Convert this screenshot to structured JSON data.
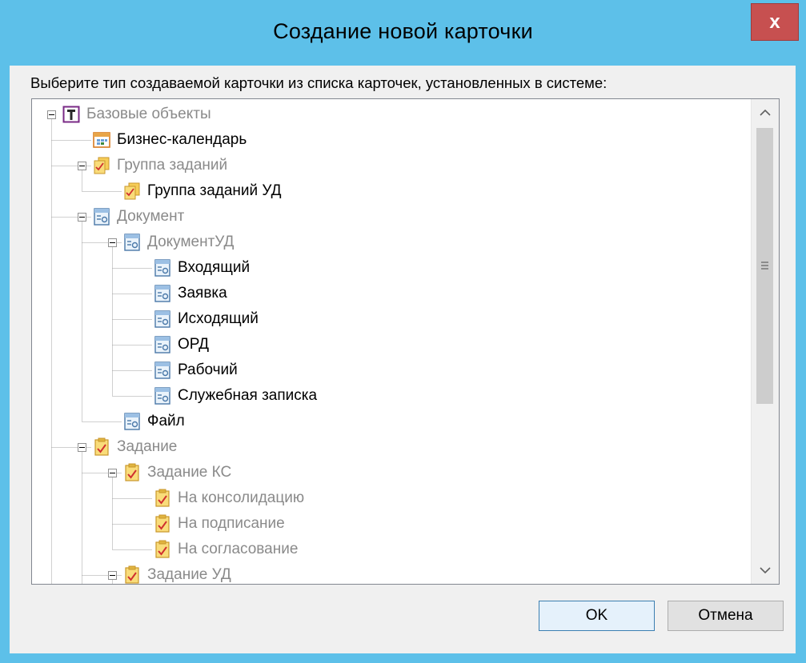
{
  "window": {
    "title": "Создание новой карточки",
    "close_label": "x"
  },
  "prompt": "Выберите тип создаваемой карточки из списка карточек, установленных в системе:",
  "tree": [
    {
      "label": "Базовые объекты",
      "icon": "tools-icon",
      "enabled": false,
      "expanded": true
    },
    {
      "label": "Бизнес-календарь",
      "icon": "calendar-icon",
      "enabled": true
    },
    {
      "label": "Группа заданий",
      "icon": "task-group-icon",
      "enabled": false,
      "expanded": true
    },
    {
      "label": "Группа заданий УД",
      "icon": "task-group-icon",
      "enabled": true
    },
    {
      "label": "Документ",
      "icon": "document-icon",
      "enabled": false,
      "expanded": true
    },
    {
      "label": "ДокументУД",
      "icon": "document-icon",
      "enabled": false,
      "expanded": true
    },
    {
      "label": "Входящий",
      "icon": "document-icon",
      "enabled": true
    },
    {
      "label": "Заявка",
      "icon": "document-icon",
      "enabled": true
    },
    {
      "label": "Исходящий",
      "icon": "document-icon",
      "enabled": true
    },
    {
      "label": "ОРД",
      "icon": "document-icon",
      "enabled": true
    },
    {
      "label": "Рабочий",
      "icon": "document-icon",
      "enabled": true
    },
    {
      "label": "Служебная записка",
      "icon": "document-icon",
      "enabled": true
    },
    {
      "label": "Файл",
      "icon": "document-icon",
      "enabled": true
    },
    {
      "label": "Задание",
      "icon": "task-icon",
      "enabled": false,
      "expanded": true
    },
    {
      "label": "Задание КС",
      "icon": "task-icon",
      "enabled": false,
      "expanded": true
    },
    {
      "label": "На консолидацию",
      "icon": "task-icon",
      "enabled": false
    },
    {
      "label": "На подписание",
      "icon": "task-icon",
      "enabled": false
    },
    {
      "label": "На согласование",
      "icon": "task-icon",
      "enabled": false
    },
    {
      "label": "Задание УД",
      "icon": "task-icon",
      "enabled": false,
      "expanded": true
    }
  ],
  "buttons": {
    "ok": "OK",
    "cancel": "Отмена"
  },
  "colors": {
    "frame": "#5dc0e9",
    "close": "#c75050",
    "disabled_text": "#8a8a8a"
  }
}
